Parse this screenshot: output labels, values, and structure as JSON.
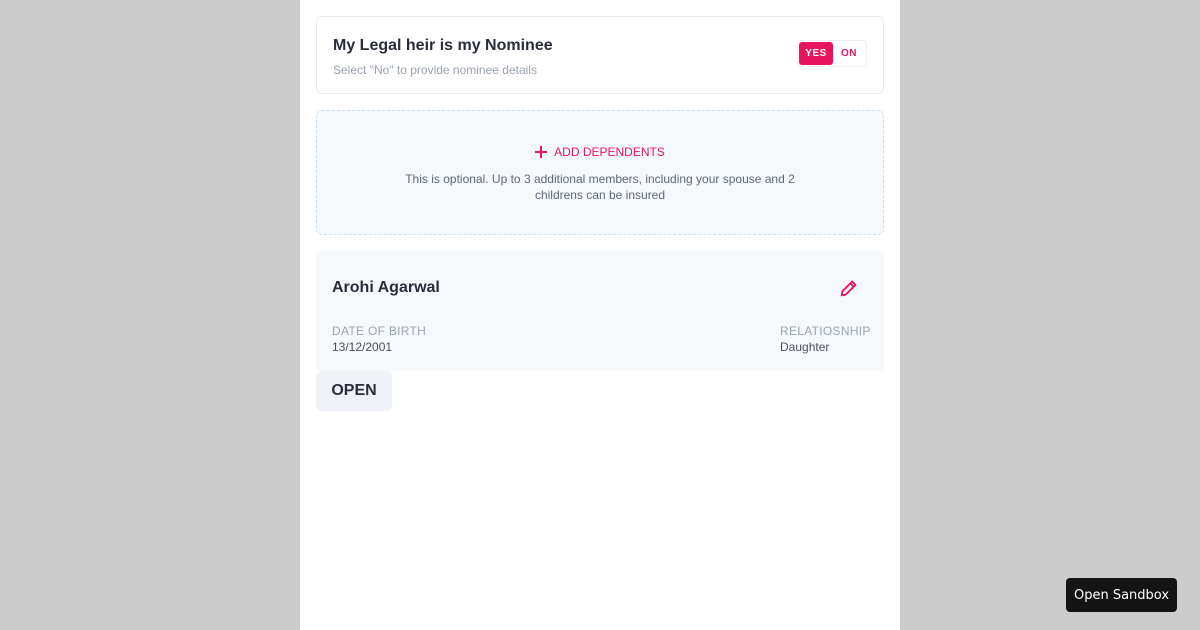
{
  "nominee": {
    "title": "My Legal heir is my Nominee",
    "subtitle": "Select \"No\" to provide nominee details",
    "toggle": {
      "yes_label": "YES",
      "no_label": "ON",
      "selected": "YES"
    }
  },
  "dependents": {
    "add_label": "ADD DEPENDENTS",
    "help_text": "This is optional. Up to 3 additional members, including your spouse and 2 childrens can be insured"
  },
  "member": {
    "name": "Arohi Agarwal",
    "dob_label": "DATE OF BIRTH",
    "dob_value": "13/12/2001",
    "relationship_label": "RELATIOSNHIP",
    "relationship_value": "Daughter"
  },
  "open_button_label": "OPEN",
  "sandbox_button_label": "Open Sandbox",
  "icons": {
    "add": "plus-icon",
    "edit": "pencil-icon"
  },
  "colors": {
    "accent": "#e8155e",
    "backdrop": "#cccccc",
    "panel": "#ffffff",
    "card_bg": "#f6f9fc"
  }
}
